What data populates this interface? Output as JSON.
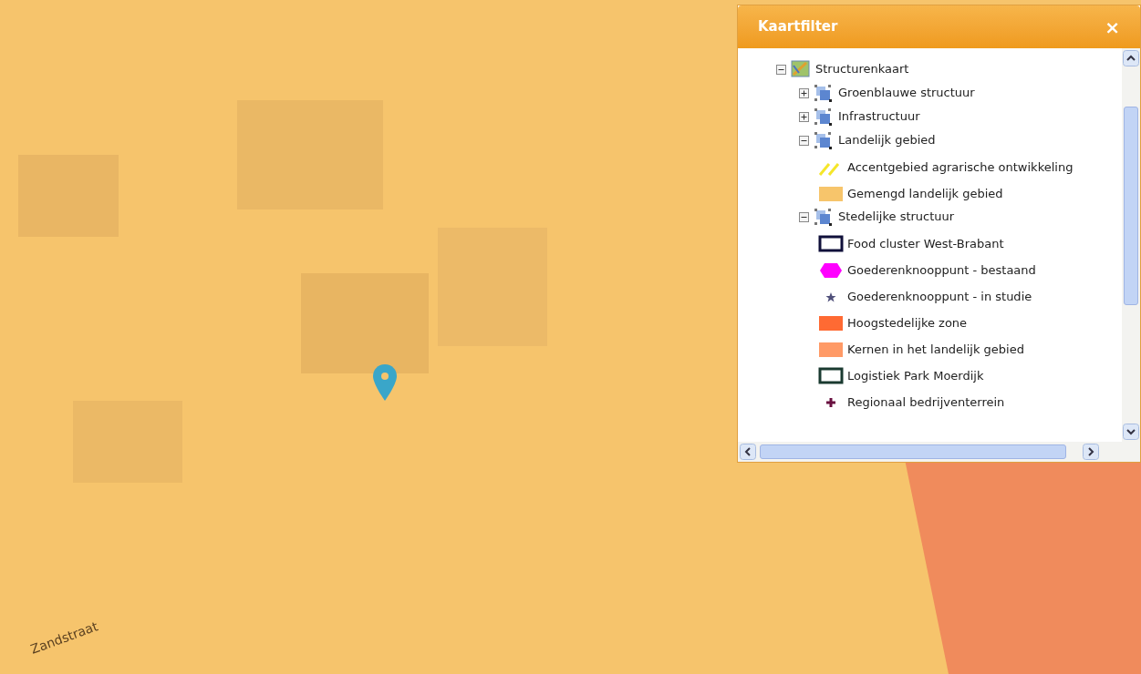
{
  "map": {
    "street_label": "Zandstraat"
  },
  "panel": {
    "title": "Kaartfilter",
    "close": "×",
    "tree": [
      {
        "label": "Structurenkaart",
        "expanded": true,
        "children": [
          {
            "label": "Groenblauwe structuur",
            "expanded": false
          },
          {
            "label": "Infrastructuur",
            "expanded": false
          },
          {
            "label": "Landelijk gebied",
            "expanded": true,
            "legend": [
              {
                "label": "Accentgebied agrarische ontwikkeling",
                "kind": "hatch",
                "color": "#f5e62a"
              },
              {
                "label": "Gemengd landelijk gebied",
                "kind": "fill",
                "color": "#f7c56b"
              }
            ]
          },
          {
            "label": "Stedelijke structuur",
            "expanded": true,
            "legend": [
              {
                "label": "Food cluster West-Brabant",
                "kind": "outline",
                "color": "#10103a"
              },
              {
                "label": "Goederenknooppunt - bestaand",
                "kind": "hexagon",
                "color": "#ff00ff"
              },
              {
                "label": "Goederenknooppunt - in studie",
                "kind": "star",
                "color": "#50507a"
              },
              {
                "label": "Hoogstedelijke zone",
                "kind": "fill",
                "color": "#ff6a33"
              },
              {
                "label": "Kernen in het landelijk gebied",
                "kind": "fill",
                "color": "#ff9a66"
              },
              {
                "label": "Logistiek Park Moerdijk",
                "kind": "outline",
                "color": "#1a3a30"
              },
              {
                "label": "Regionaal bedrijventerrein",
                "kind": "plus",
                "color": "#6a1040"
              }
            ]
          }
        ]
      }
    ]
  }
}
